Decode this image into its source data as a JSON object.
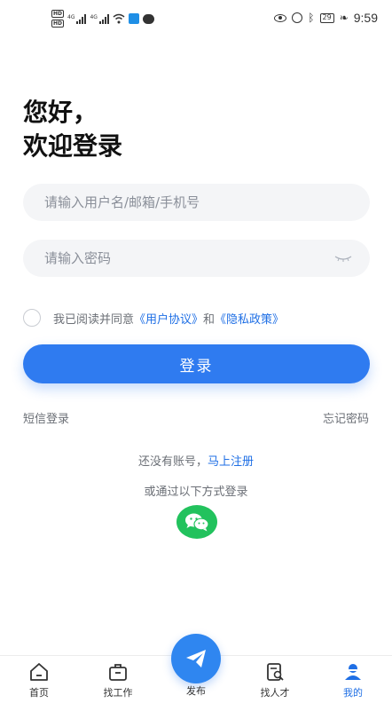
{
  "status_bar": {
    "hd_badges": [
      "HD",
      "HD"
    ],
    "signal_labels": [
      "4G",
      "4G"
    ],
    "battery": "29",
    "time": "9:59"
  },
  "greeting": {
    "line1": "您好，",
    "line2": "欢迎登录"
  },
  "form": {
    "username_placeholder": "请输入用户名/邮箱/手机号",
    "password_placeholder": "请输入密码"
  },
  "agreement": {
    "prefix": "我已阅读并同意",
    "user_agreement": "《用户协议》",
    "and": "和",
    "privacy_policy": "《隐私政策》"
  },
  "login_button": "登录",
  "sms_login": "短信登录",
  "forgot_password": "忘记密码",
  "register": {
    "prefix": "还没有账号，",
    "link": "马上注册"
  },
  "other_login_label": "或通过以下方式登录",
  "nav": {
    "home": "首页",
    "find_job": "找工作",
    "publish": "发布",
    "find_talent": "找人才",
    "mine": "我的"
  },
  "colors": {
    "accent": "#2f7bf0",
    "link": "#1f6fe5",
    "wechat": "#22c25d"
  }
}
